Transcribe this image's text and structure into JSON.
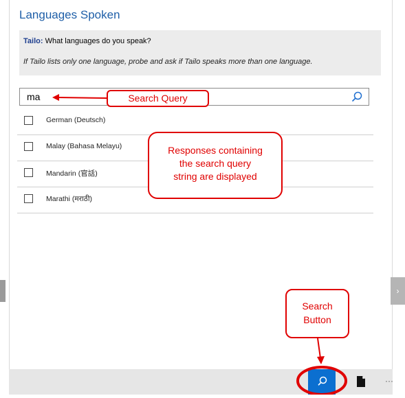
{
  "title": "Languages Spoken",
  "question": {
    "speaker": "Tailo:",
    "text": " What languages do you speak?"
  },
  "instruction": "If Tailo lists only one language, probe and ask if Tailo speaks more than one language.",
  "search": {
    "query": "ma"
  },
  "options": [
    {
      "label": "German (Deutsch)"
    },
    {
      "label": "Malay (Bahasa Melayu)"
    },
    {
      "label": "Mandarin (官話)"
    },
    {
      "label": "Marathi (मराठी)"
    }
  ],
  "nav": {
    "next_glyph": "›"
  },
  "bottom_bar": {
    "more_glyph": "···",
    "icons": [
      "search-icon",
      "document-icon",
      "more-icon"
    ]
  },
  "annotations": {
    "search_query": "Search Query",
    "responses_line1": "Responses containing",
    "responses_line2": "the search query",
    "responses_line3": "string are displayed",
    "search_button_line1": "Search",
    "search_button_line2": "Button"
  },
  "colors": {
    "accent": "#0b6fd0",
    "annotation": "#e00000",
    "title": "#1f5fa8"
  }
}
